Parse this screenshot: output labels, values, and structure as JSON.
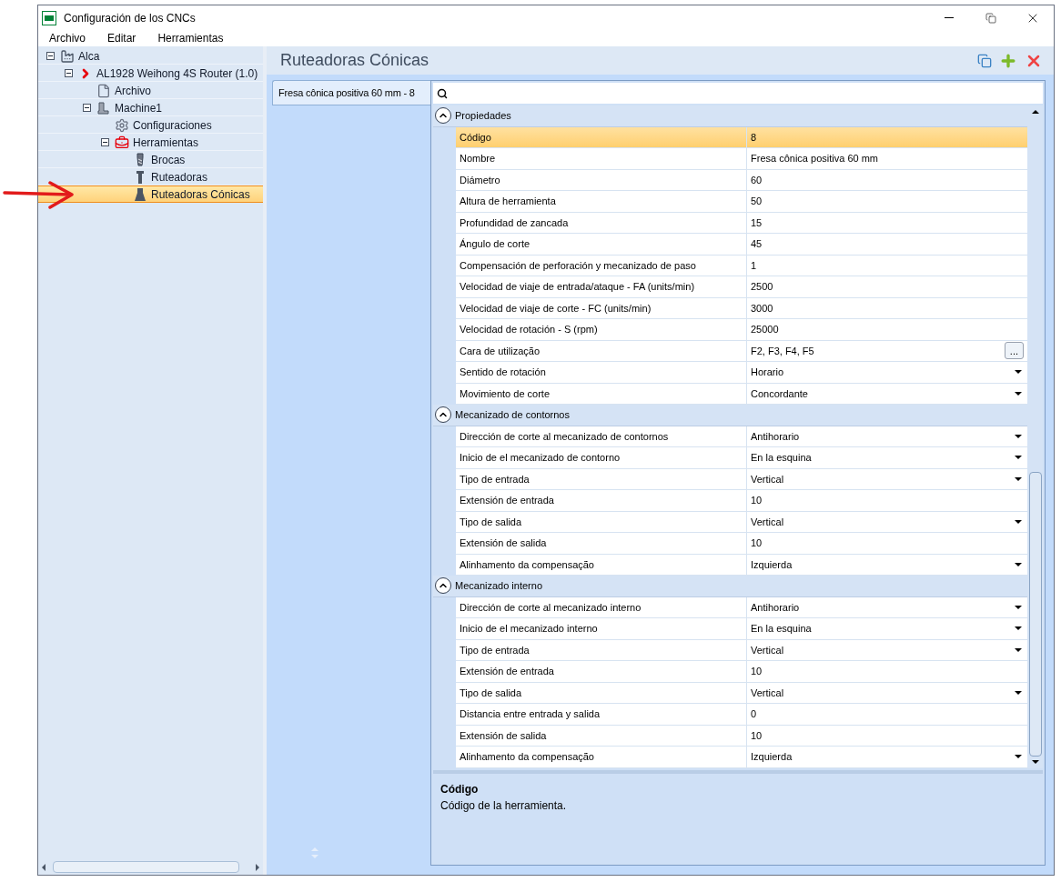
{
  "window": {
    "title": "Configuración de los CNCs"
  },
  "menu": [
    "Archivo",
    "Editar",
    "Herramientas"
  ],
  "tree": [
    {
      "label": "Alca",
      "kind": "company",
      "expanded": true,
      "selected": false,
      "children": [
        {
          "label": "AL1928 Weihong 4S Router (1.0)",
          "kind": "router",
          "expanded": true,
          "selected": false,
          "children": [
            {
              "label": "Archivo",
              "kind": "file",
              "selected": false
            },
            {
              "label": "Machine1",
              "kind": "machine",
              "expanded": true,
              "selected": false,
              "children": [
                {
                  "label": "Configuraciones",
                  "kind": "settings",
                  "selected": false
                },
                {
                  "label": "Herramientas",
                  "kind": "toolbox",
                  "expanded": true,
                  "selected": false,
                  "children": [
                    {
                      "label": "Brocas",
                      "kind": "drill",
                      "selected": false
                    },
                    {
                      "label": "Ruteadoras",
                      "kind": "bit",
                      "selected": false
                    },
                    {
                      "label": "Ruteadoras Cónicas",
                      "kind": "conical",
                      "selected": true
                    }
                  ]
                }
              ]
            }
          ]
        }
      ]
    }
  ],
  "header": {
    "title": "Ruteadoras Cónicas"
  },
  "tools": [
    {
      "label": "Fresa cônica positiva 60 mm - 8",
      "selected": true
    }
  ],
  "categories": [
    {
      "title": "Propiedades",
      "expanded": true,
      "rows": [
        {
          "name": "Código",
          "value": "8",
          "kind": "text",
          "selected": true
        },
        {
          "name": "Nombre",
          "value": "Fresa cônica positiva 60 mm",
          "kind": "text",
          "selected": false
        },
        {
          "name": "Diámetro",
          "value": "60",
          "kind": "text",
          "selected": false
        },
        {
          "name": "Altura de herramienta",
          "value": "50",
          "kind": "text",
          "selected": false
        },
        {
          "name": "Profundidad de zancada",
          "value": "15",
          "kind": "text",
          "selected": false
        },
        {
          "name": "Ángulo de corte",
          "value": "45",
          "kind": "text",
          "selected": false
        },
        {
          "name": "Compensación de perforación y mecanizado de paso",
          "value": "1",
          "kind": "text",
          "selected": false
        },
        {
          "name": "Velocidad de viaje de entrada/ataque - FA (units/min)",
          "value": "2500",
          "kind": "text",
          "selected": false
        },
        {
          "name": "Velocidad de viaje de corte - FC (units/min)",
          "value": "3000",
          "kind": "text",
          "selected": false
        },
        {
          "name": "Velocidad de rotación - S (rpm)",
          "value": "25000",
          "kind": "text",
          "selected": false
        },
        {
          "name": "Cara de utilização",
          "value": "F2, F3, F4, F5",
          "kind": "ellipsis",
          "button": "...",
          "selected": false
        },
        {
          "name": "Sentido de rotación",
          "value": "Horario",
          "kind": "dropdown",
          "selected": false
        },
        {
          "name": "Movimiento de corte",
          "value": "Concordante",
          "kind": "dropdown",
          "selected": false
        }
      ]
    },
    {
      "title": "Mecanizado de contornos",
      "expanded": true,
      "rows": [
        {
          "name": "Dirección de corte al mecanizado de contornos",
          "value": "Antihorario",
          "kind": "dropdown",
          "selected": false
        },
        {
          "name": "Inicio de el mecanizado de contorno",
          "value": "En la esquina",
          "kind": "dropdown",
          "selected": false
        },
        {
          "name": "Tipo de entrada",
          "value": "Vertical",
          "kind": "dropdown",
          "selected": false
        },
        {
          "name": "Extensión de entrada",
          "value": "10",
          "kind": "text",
          "selected": false
        },
        {
          "name": "Tipo de salida",
          "value": "Vertical",
          "kind": "dropdown",
          "selected": false
        },
        {
          "name": "Extensión de salida",
          "value": "10",
          "kind": "text",
          "selected": false
        },
        {
          "name": "Alinhamento da compensação",
          "value": "Izquierda",
          "kind": "dropdown",
          "selected": false
        }
      ]
    },
    {
      "title": "Mecanizado interno",
      "expanded": true,
      "rows": [
        {
          "name": "Dirección de corte al mecanizado interno",
          "value": "Antihorario",
          "kind": "dropdown",
          "selected": false
        },
        {
          "name": "Inicio de el mecanizado interno",
          "value": "En la esquina",
          "kind": "dropdown",
          "selected": false
        },
        {
          "name": "Tipo de entrada",
          "value": "Vertical",
          "kind": "dropdown",
          "selected": false
        },
        {
          "name": "Extensión de entrada",
          "value": "10",
          "kind": "text",
          "selected": false
        },
        {
          "name": "Tipo de salida",
          "value": "Vertical",
          "kind": "dropdown",
          "selected": false
        },
        {
          "name": "Distancia entre entrada y salida",
          "value": "0",
          "kind": "text",
          "selected": false
        },
        {
          "name": "Extensión de salida",
          "value": "10",
          "kind": "text",
          "selected": false
        },
        {
          "name": "Alinhamento da compensação",
          "value": "Izquierda",
          "kind": "dropdown",
          "selected": false
        }
      ]
    }
  ],
  "description": {
    "title": "Código",
    "text": "Código de la herramienta."
  }
}
